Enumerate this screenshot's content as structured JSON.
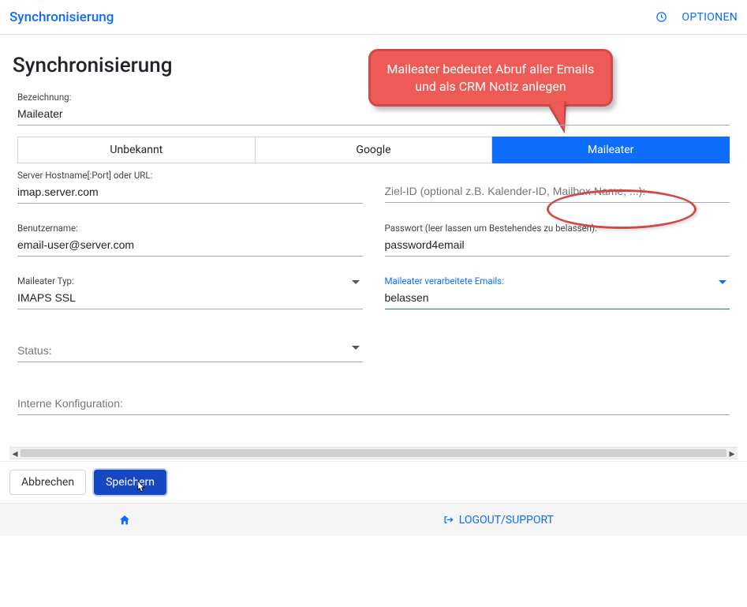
{
  "topbar": {
    "title": "Synchronisierung",
    "options_label": "OPTIONEN"
  },
  "page": {
    "heading": "Synchronisierung"
  },
  "callout": {
    "text": "Maileater bedeutet Abruf aller Emails und als CRM Notiz anlegen"
  },
  "segmented": {
    "options": [
      "Unbekannt",
      "Google",
      "Maileater"
    ],
    "active_index": 2
  },
  "fields": {
    "bezeichnung": {
      "label": "Bezeichnung:",
      "value": "Maileater"
    },
    "server": {
      "label": "Server Hostname[:Port] oder URL:",
      "value": "imap.server.com"
    },
    "ziel_id": {
      "placeholder": "Ziel-ID (optional z.B. Kalender-ID, Mailbox Name, ...):"
    },
    "benutzername": {
      "label": "Benutzername:",
      "value": "email-user@server.com"
    },
    "passwort": {
      "label": "Passwort (leer lassen um Bestehendes zu belassen):",
      "value": "password4email"
    },
    "maileater_typ": {
      "label": "Maileater Typ:",
      "value": "IMAPS SSL"
    },
    "verarbeitete": {
      "label": "Maileater verarbeitete Emails:",
      "value": "belassen"
    },
    "status": {
      "placeholder": "Status:"
    },
    "interne_konfig": {
      "placeholder": "Interne Konfiguration:"
    }
  },
  "actions": {
    "cancel": "Abbrechen",
    "save": "Speichern"
  },
  "footer": {
    "logout": "LOGOUT/SUPPORT"
  }
}
